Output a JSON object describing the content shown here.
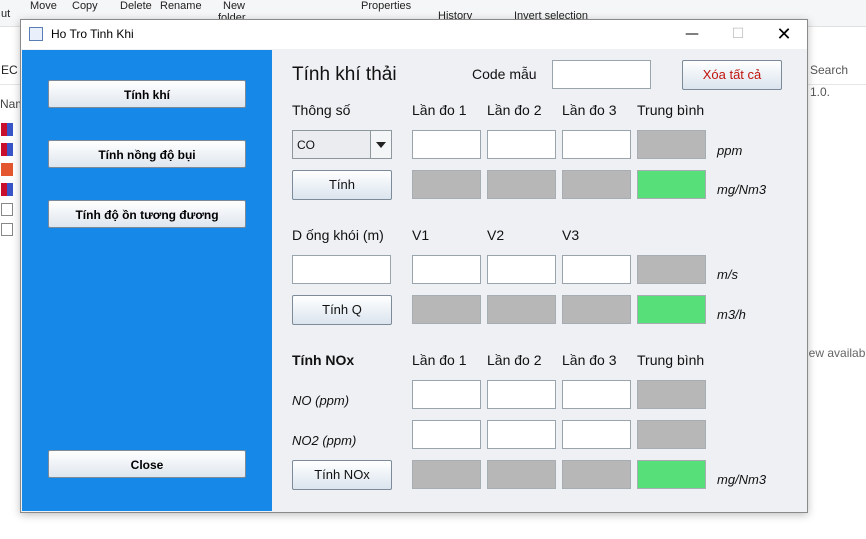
{
  "background": {
    "ribbon": [
      "ut",
      "Move",
      "Copy",
      "Delete",
      "Rename",
      "New",
      "folder",
      "Properties",
      "History",
      "Invert selection"
    ],
    "address_left": "EC (",
    "search_text": "Search 1.0.",
    "nav_label": "Nam",
    "preview_text": "iew availabl"
  },
  "window": {
    "title": "Ho Tro Tinh Khi",
    "min_glyph": "—",
    "max_glyph": "☐",
    "close_glyph": "✕"
  },
  "left_menu": {
    "btn_tinh_khi": "Tính khí",
    "btn_tinh_bui": "Tính nồng độ bụi",
    "btn_tinh_on": "Tính độ ồn tương đương",
    "btn_close": "Close"
  },
  "main": {
    "heading": "Tính khí thải",
    "code_label": "Code mẫu",
    "code_value": "",
    "clear_all": "Xóa tất cả",
    "param_label": "Thông số",
    "col_lan1": "Lần đo 1",
    "col_lan2": "Lần đo 2",
    "col_lan3": "Lần đo 3",
    "col_tb": "Trung bình",
    "pollutant_selected": "CO",
    "unit_ppm": "ppm",
    "calc_button": "Tính",
    "unit_mgnm3": "mg/Nm3",
    "diameter_label": "D ống khói (m)",
    "v1": "V1",
    "v2": "V2",
    "v3": "V3",
    "unit_ms": "m/s",
    "calc_q_button": "Tính Q",
    "unit_m3h": "m3/h",
    "nox_heading": "Tính NOx",
    "nox_lan1": "Lần đo 1",
    "nox_lan2": "Lần đo 2",
    "nox_lan3": "Lần đo 3",
    "nox_tb": "Trung bình",
    "no_label": "NO (ppm)",
    "no2_label": "NO2 (ppm)",
    "calc_nox_button": "Tính NOx",
    "unit_nox": "mg/Nm3"
  }
}
